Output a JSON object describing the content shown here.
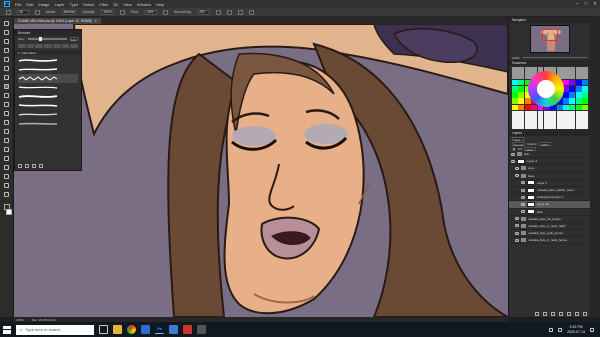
{
  "menubar": {
    "app_logo": "Ps",
    "items": [
      "File",
      "Edit",
      "Image",
      "Layer",
      "Type",
      "Select",
      "Filter",
      "3D",
      "View",
      "Window",
      "Help"
    ],
    "window_controls": [
      "–",
      "□",
      "✕"
    ]
  },
  "options": {
    "brush_size": "40",
    "mode_label": "Mode:",
    "mode_value": "Normal",
    "opacity_label": "Opacity:",
    "opacity_value": "100%",
    "flow_label": "Flow:",
    "flow_value": "40%",
    "smoothing_label": "Smoothing:",
    "smoothing_value": "0%"
  },
  "document_tab": {
    "title": "CHASE MELONA.psd @ 105% (Layer 12, RGB/8)",
    "close": "×"
  },
  "brushes_panel": {
    "title": "Brushes",
    "size_label": "Size:",
    "size_value": "126",
    "folder_label": "Inkbrushes"
  },
  "right_panel": {
    "navigator_title": "Navigator",
    "zoom_value": "105%",
    "swatches_title": "Swatches",
    "layers_title": "Layers",
    "kind_label": "Kind",
    "blend_mode": "Normal",
    "opacity_label": "Opacity:",
    "opacity_value": "100%",
    "fill_label": "Fill:",
    "fill_value": "100%",
    "layers": [
      {
        "name": "skin",
        "type": "folder",
        "indent": 0,
        "selected": false
      },
      {
        "name": "Layer 4",
        "type": "layer",
        "indent": 0,
        "selected": false
      },
      {
        "name": "eyes",
        "type": "folder",
        "indent": 1,
        "selected": false
      },
      {
        "name": "base",
        "type": "folder",
        "indent": 1,
        "selected": false
      },
      {
        "name": "Layer 1",
        "type": "layer",
        "indent": 2,
        "selected": false
      },
      {
        "name": "melodie_face_sketch_overl",
        "type": "layer",
        "indent": 2,
        "selected": false
      },
      {
        "name": "Hintergrund Layer 2",
        "type": "layer",
        "indent": 2,
        "selected": false
      },
      {
        "name": "Layer 12",
        "type": "layer",
        "indent": 2,
        "selected": true
      },
      {
        "name": "face",
        "type": "layer",
        "indent": 2,
        "selected": false
      },
      {
        "name": "melodie_face_01_bones",
        "type": "folder",
        "indent": 1,
        "selected": false
      },
      {
        "name": "melodie_face_1_neck_hallo",
        "type": "folder",
        "indent": 1,
        "selected": false
      },
      {
        "name": "melodie_face_pink_bones",
        "type": "folder",
        "indent": 1,
        "selected": false
      },
      {
        "name": "melodie_face_2_neck_bones",
        "type": "folder",
        "indent": 1,
        "selected": false
      }
    ]
  },
  "status": {
    "zoom": "105%",
    "doc_size": "Doc: 26.3M/3.24G"
  },
  "taskbar": {
    "search_placeholder": "Type here to search",
    "time": "2:43 PM",
    "date": "2020-07-13"
  },
  "colors": {
    "canvas_bg": "#7a6e85",
    "hat": "#e2b48e",
    "hat_band": "#3c3150",
    "hair": "#6b4a35",
    "skin": "#e8b088",
    "lips": "#b88e98",
    "eyeshadow": "#b4aab4",
    "line": "#2a1a14"
  }
}
